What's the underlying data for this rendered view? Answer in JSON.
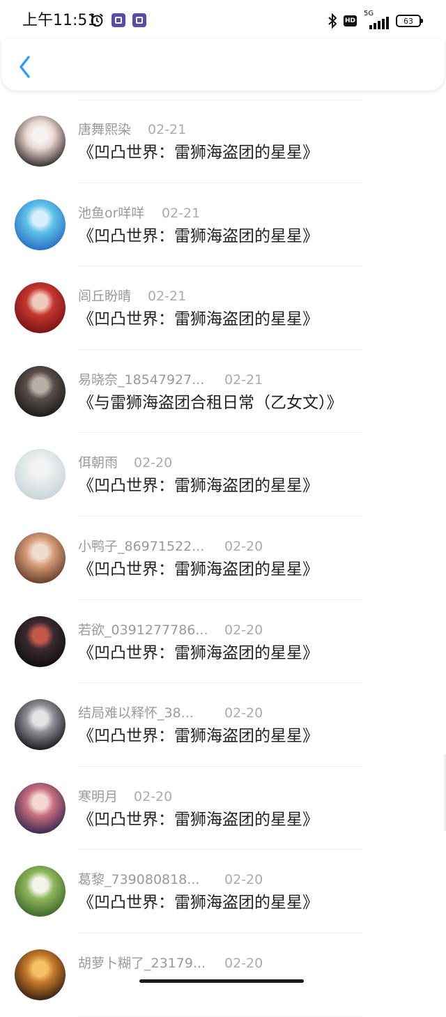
{
  "status_bar": {
    "time": "上午11:51",
    "network": "5G",
    "hd": "HD",
    "battery": "63"
  },
  "header": {
    "back_icon": "chevron-left-icon",
    "accent_color": "#2f9bf0"
  },
  "entries": [
    {
      "username": "唐舞熙染",
      "date": "02-21",
      "book": "《凹凸世界：雷狮海盗团的星星》",
      "avatar_colors": [
        "#3a3134",
        "#e9d7cf",
        "#f4f1f1"
      ]
    },
    {
      "username": "池鱼or咩咩",
      "date": "02-21",
      "book": "《凹凸世界：雷狮海盗团的星星》",
      "avatar_colors": [
        "#2a6fc4",
        "#5fc3e9",
        "#d7eefb"
      ]
    },
    {
      "username": "闾丘盼晴",
      "date": "02-21",
      "book": "《凹凸世界：雷狮海盗团的星星》",
      "avatar_colors": [
        "#7a1416",
        "#c4372f",
        "#efc8b9"
      ]
    },
    {
      "username": "易晓奈_18547927...",
      "date": "02-21",
      "book": "《与雷狮海盗团合租日常（乙女文）》",
      "avatar_colors": [
        "#1d1c1c",
        "#5a4e49",
        "#b9aea5"
      ]
    },
    {
      "username": "佴朝雨",
      "date": "02-20",
      "book": "《凹凸世界：雷狮海盗团的星星》",
      "avatar_colors": [
        "#c9d5d8",
        "#e6ebec",
        "#f3f5f5"
      ]
    },
    {
      "username": "小鸭子_86971522...",
      "date": "02-20",
      "book": "《凹凸世界：雷狮海盗团的星星》",
      "avatar_colors": [
        "#6b3f2a",
        "#d69d7a",
        "#f0dccd"
      ]
    },
    {
      "username": "若欲_0391277786...",
      "date": "02-20",
      "book": "《凹凸世界：雷狮海盗团的星星》",
      "avatar_colors": [
        "#0f0f14",
        "#3b2b2f",
        "#c2574a"
      ]
    },
    {
      "username": "结局难以释怀_38...",
      "date": "02-20",
      "book": "《凹凸世界：雷狮海盗团的星星》",
      "avatar_colors": [
        "#1c1c20",
        "#8d8f96",
        "#e3e3e6"
      ]
    },
    {
      "username": "寒明月",
      "date": "02-20",
      "book": "《凹凸世界：雷狮海盗团的星星》",
      "avatar_colors": [
        "#3d2a4f",
        "#c96f7f",
        "#f2d7d2"
      ]
    },
    {
      "username": "葛黎_739080818...",
      "date": "02-20",
      "book": "《凹凸世界：雷狮海盗团的星星》",
      "avatar_colors": [
        "#3f6a2a",
        "#8fb65c",
        "#f3f3ea"
      ]
    },
    {
      "username": "胡萝卜糊了_23179...",
      "date": "02-20",
      "book": "",
      "avatar_colors": [
        "#3a2414",
        "#c87a2a",
        "#f3c267"
      ]
    }
  ]
}
